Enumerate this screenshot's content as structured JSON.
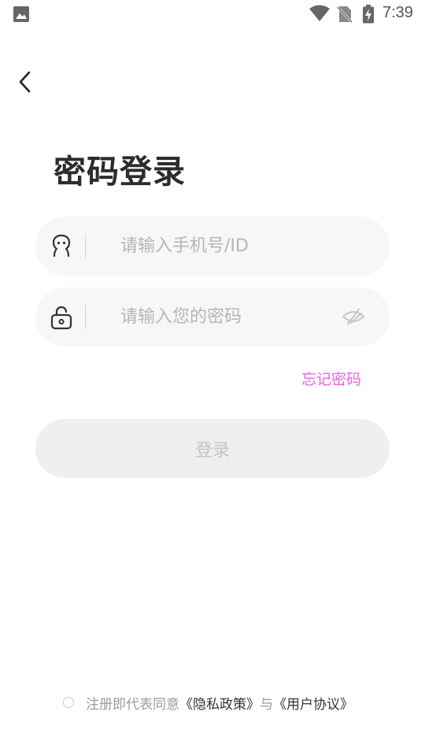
{
  "status_bar": {
    "time": "7:39",
    "icons": [
      "gallery-icon",
      "wifi-icon",
      "no-sim-icon",
      "battery-charging-icon"
    ]
  },
  "nav": {
    "back_icon": "chevron-left-icon"
  },
  "title": "密码登录",
  "phone_field": {
    "icon": "user-icon",
    "placeholder": "请输入手机号/ID",
    "value": ""
  },
  "password_field": {
    "icon": "lock-icon",
    "placeholder": "请输入您的密码",
    "value": "",
    "toggle_icon": "eye-off-icon"
  },
  "forgot_password": "忘记密码",
  "login_button": "登录",
  "agreement": {
    "prefix": "注册即代表同意",
    "privacy_link": "《隐私政策》",
    "connector": "与",
    "terms_link": "《用户协议》",
    "checked": false
  },
  "colors": {
    "accent": "#ea62e0",
    "field_bg": "#f6f7f9",
    "button_disabled_bg": "#efefef",
    "button_disabled_text": "#c4c4c4"
  }
}
